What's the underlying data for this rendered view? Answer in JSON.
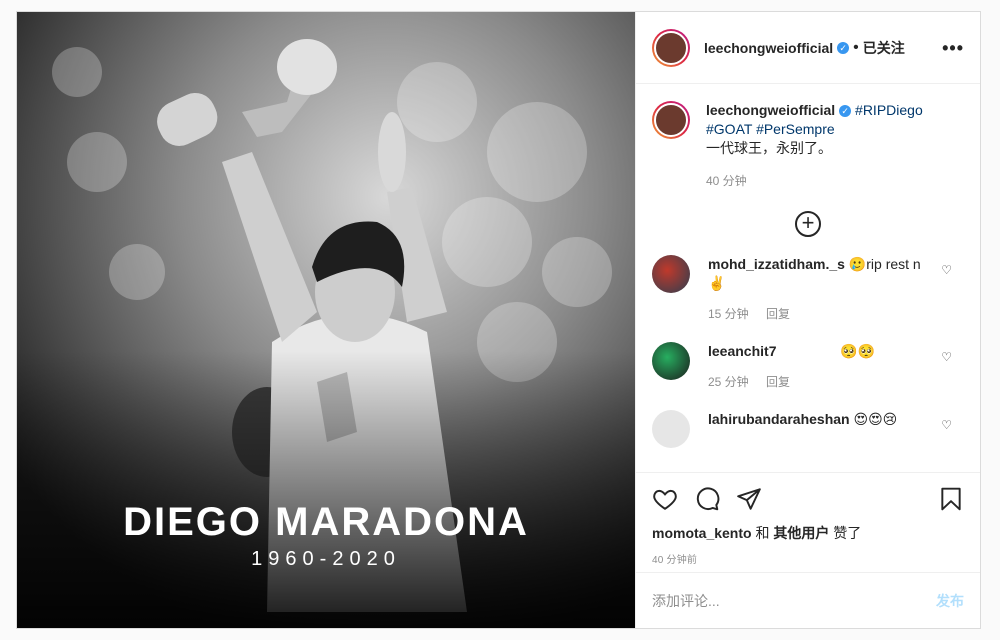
{
  "media": {
    "title": "DIEGO MARADONA",
    "years": "1960-2020"
  },
  "header": {
    "username": "leechongweiofficial",
    "separator": "•",
    "follow_label": "已关注",
    "more": "•••"
  },
  "caption": {
    "username": "leechongweiofficial",
    "hashtags": [
      "#RIPDiego",
      "#GOAT",
      "#PerSempre"
    ],
    "text": "一代球王，永别了。",
    "time": "40 分钟"
  },
  "load_more": "+",
  "comments": [
    {
      "username": "mohd_izzatidham._s",
      "text": "🥲rip rest n ✌️",
      "time": "15 分钟",
      "reply": "回复"
    },
    {
      "username": "leeanchit7",
      "text": "🥺🥺",
      "time": "25 分钟",
      "reply": "回复"
    },
    {
      "username": "lahirubandaraheshan",
      "text": "😍😍😢",
      "time": "",
      "reply": ""
    }
  ],
  "likes": {
    "user": "momota_kento",
    "connector": "和",
    "others": "其他用户",
    "suffix": "赞了"
  },
  "posted_ago": "40 分钟前",
  "add_comment": {
    "placeholder": "添加评论...",
    "post_label": "发布"
  },
  "colors": {
    "link": "#00376b",
    "verified": "#3897f0",
    "post_button_disabled": "#b2dffc"
  }
}
